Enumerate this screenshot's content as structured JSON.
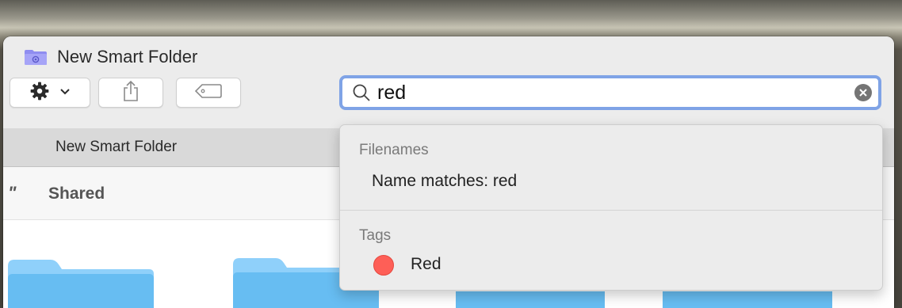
{
  "window": {
    "title": "New Smart Folder",
    "tab_label": "New Smart Folder"
  },
  "toolbar": {
    "action_icon": "gear-icon",
    "share_icon": "share-icon",
    "tag_icon": "tag-icon"
  },
  "search": {
    "value": "red",
    "icon": "search-icon",
    "clear_icon": "clear-icon"
  },
  "results": {
    "section_label": "Shared",
    "quote_mark": "\""
  },
  "suggestions": {
    "filenames_heading": "Filenames",
    "filenames_item": "Name matches: red",
    "tags_heading": "Tags",
    "tag_item": "Red",
    "tag_color": "#fe5f57"
  },
  "colors": {
    "focus_ring": "#7fa3e6",
    "folder_blue": "#67bdf2",
    "folder_tab": "#8fd0fa"
  }
}
